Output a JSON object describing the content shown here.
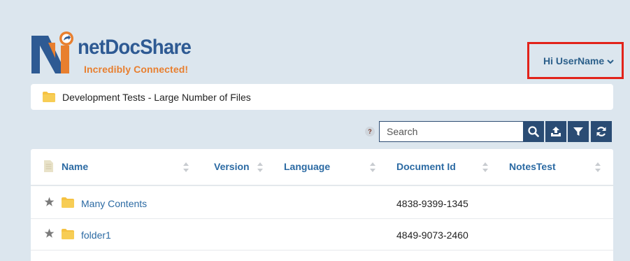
{
  "logo": {
    "name": "netDocShare",
    "tagline": "Incredibly Connected!"
  },
  "user_menu": {
    "label": "Hi UserName"
  },
  "breadcrumb": {
    "folder_name": "Development Tests - Large Number of Files"
  },
  "toolbar": {
    "help_label": "?",
    "search_placeholder": "Search",
    "search_value": ""
  },
  "table": {
    "columns": [
      "Name",
      "Version",
      "Language",
      "Document Id",
      "NotesTest"
    ],
    "rows": [
      {
        "name": "Many Contents",
        "document_id": "4838-9399-1345"
      },
      {
        "name": "folder1",
        "document_id": "4849-9073-2460"
      }
    ]
  },
  "colors": {
    "background": "#dce6ee",
    "brand_blue": "#2e5a93",
    "brand_orange": "#e87f2f",
    "link": "#2b6aa3",
    "toolbar_button": "#2a4c74",
    "highlight_border": "#e2231a",
    "folder": "#f5c242"
  }
}
